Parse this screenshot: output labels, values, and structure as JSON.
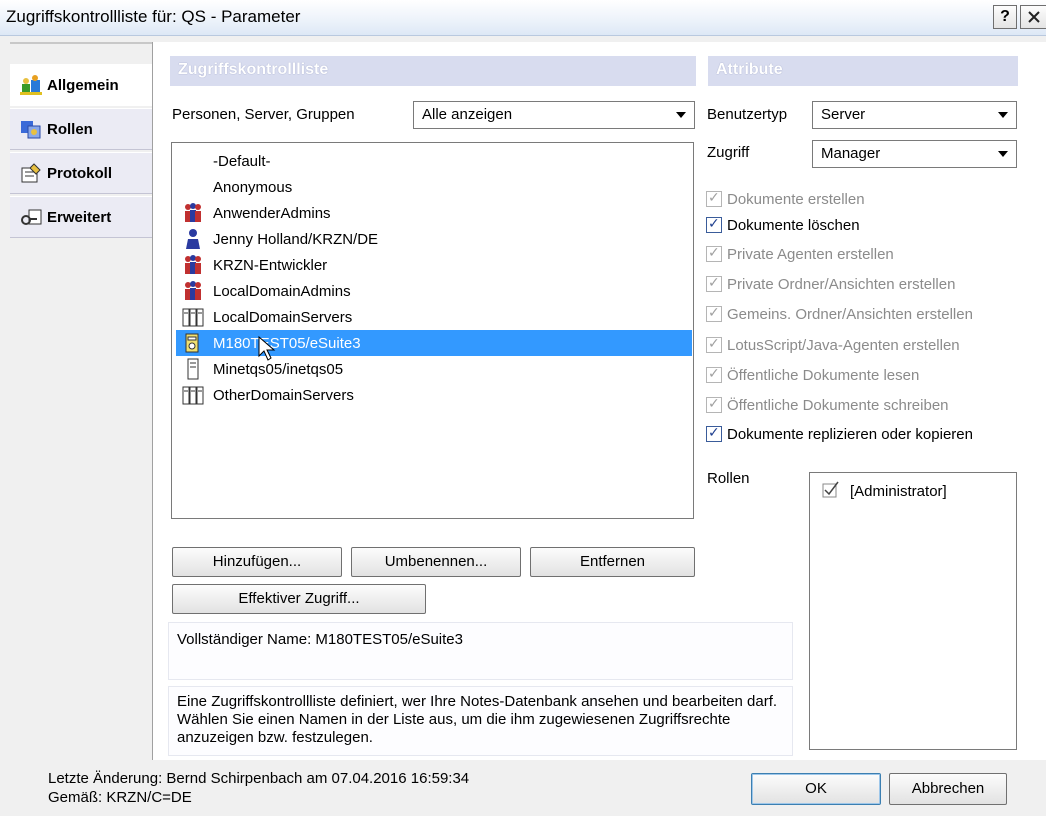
{
  "window": {
    "title": "Zugriffskontrollliste für: QS - Parameter",
    "help_label": "?",
    "close_label": "✕"
  },
  "tabs": [
    {
      "label": "Allgemein",
      "icon": "users-icon",
      "active": true
    },
    {
      "label": "Rollen",
      "icon": "roles-icon",
      "active": false
    },
    {
      "label": "Protokoll",
      "icon": "log-icon",
      "active": false
    },
    {
      "label": "Erweitert",
      "icon": "keys-icon",
      "active": false
    }
  ],
  "acl": {
    "header": "Zugriffskontrollliste",
    "filter_label": "Personen, Server, Gruppen",
    "filter_value": "Alle anzeigen",
    "entries": [
      {
        "name": "-Default-",
        "icon": "none"
      },
      {
        "name": "Anonymous",
        "icon": "none"
      },
      {
        "name": "AnwenderAdmins",
        "icon": "group-icon"
      },
      {
        "name": "Jenny Holland/KRZN/DE",
        "icon": "person-icon"
      },
      {
        "name": "KRZN-Entwickler",
        "icon": "group-icon"
      },
      {
        "name": "LocalDomainAdmins",
        "icon": "group-icon"
      },
      {
        "name": "LocalDomainServers",
        "icon": "server-group-icon"
      },
      {
        "name": "M180TEST05/eSuite3",
        "icon": "server-icon",
        "selected": true
      },
      {
        "name": "Minetqs05/inetqs05",
        "icon": "server-icon"
      },
      {
        "name": "OtherDomainServers",
        "icon": "server-group-icon"
      }
    ],
    "buttons": {
      "add": "Hinzufügen...",
      "rename": "Umbenennen...",
      "remove": "Entfernen",
      "effective": "Effektiver Zugriff..."
    },
    "full_name": "Vollständiger Name: M180TEST05/eSuite3",
    "description": "Eine Zugriffskontrollliste definiert, wer Ihre Notes-Datenbank ansehen und bearbeiten darf. Wählen Sie einen Namen in der Liste aus, um die ihm zugewiesenen Zugriffsrechte anzuzeigen bzw. festzulegen."
  },
  "attributes": {
    "header": "Attribute",
    "user_type_label": "Benutzertyp",
    "user_type_value": "Server",
    "access_label": "Zugriff",
    "access_value": "Manager",
    "checkboxes": [
      {
        "label": "Dokumente erstellen",
        "checked": true,
        "enabled": false
      },
      {
        "label": "Dokumente löschen",
        "checked": true,
        "enabled": true
      },
      {
        "label": "Private Agenten erstellen",
        "checked": true,
        "enabled": false
      },
      {
        "label": "Private Ordner/Ansichten erstellen",
        "checked": true,
        "enabled": false
      },
      {
        "label": "Gemeins. Ordner/Ansichten erstellen",
        "checked": true,
        "enabled": false
      },
      {
        "label": "LotusScript/Java-Agenten erstellen",
        "checked": true,
        "enabled": false
      },
      {
        "label": "Öffentliche Dokumente lesen",
        "checked": true,
        "enabled": false
      },
      {
        "label": "Öffentliche Dokumente schreiben",
        "checked": true,
        "enabled": false
      },
      {
        "label": "Dokumente replizieren oder kopieren",
        "checked": true,
        "enabled": true
      }
    ],
    "roles_label": "Rollen",
    "roles": [
      {
        "label": "[Administrator]",
        "checked": true
      }
    ]
  },
  "footer": {
    "last_change": "Letzte Änderung: Bernd Schirpenbach am 07.04.2016 16:59:34",
    "according": "Gemäß: KRZN/C=DE",
    "ok": "OK",
    "cancel": "Abbrechen"
  },
  "colors": {
    "selection": "#3399ff",
    "section_header": "#d8dcef",
    "tab_bg": "#ebebf4"
  }
}
